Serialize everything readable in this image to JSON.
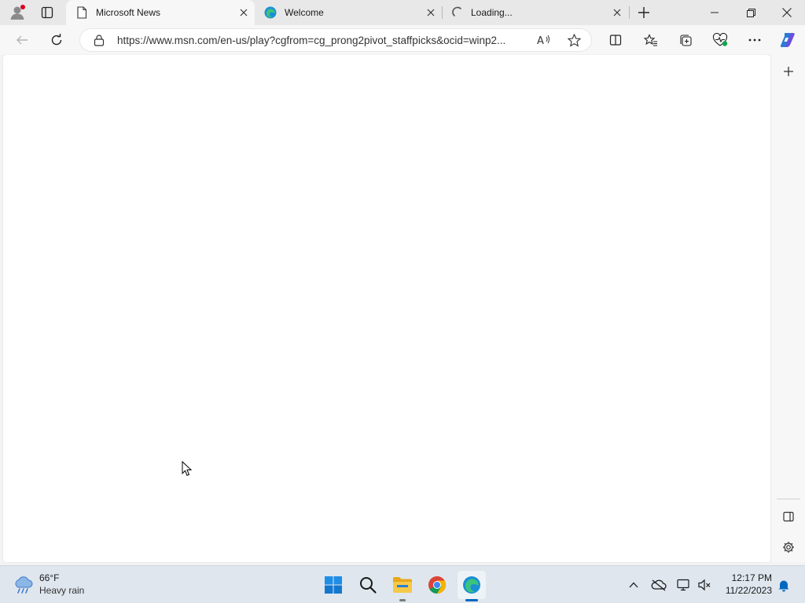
{
  "browser": {
    "tabs": [
      {
        "title": "Microsoft News",
        "icon": "page-icon",
        "active": true
      },
      {
        "title": "Welcome",
        "icon": "edge-icon",
        "active": false
      },
      {
        "title": "Loading...",
        "icon": "loading-spinner-icon",
        "active": false
      }
    ],
    "address_url": "https://www.msn.com/en-us/play?cgfrom=cg_prong2pivot_staffpicks&ocid=winp2..."
  },
  "taskbar": {
    "weather": {
      "temperature": "66°F",
      "condition": "Heavy rain"
    },
    "clock": {
      "time": "12:17 PM",
      "date": "11/22/2023"
    }
  },
  "colors": {
    "accent": "#0067c0",
    "titlebar": "#e8e8e8",
    "toolbar": "#f7f7f7",
    "taskbar": "#dfe6ee"
  }
}
